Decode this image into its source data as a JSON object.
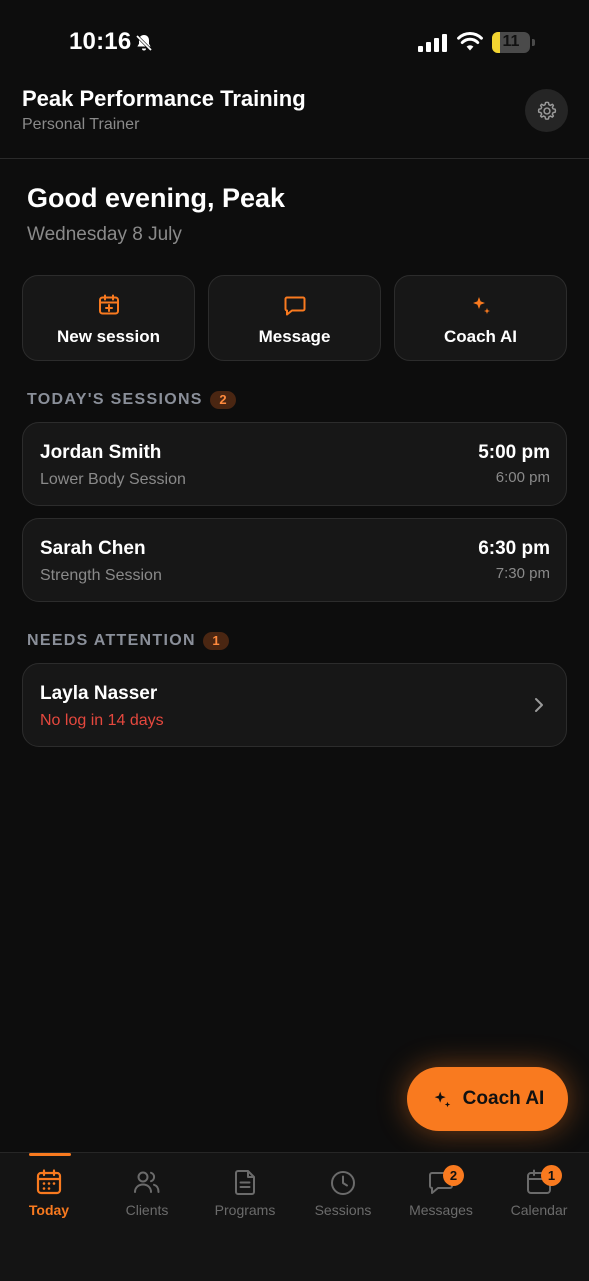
{
  "status_bar": {
    "time": "10:16",
    "battery_level": "11",
    "battery_fraction": 0.11,
    "battery_color": "#f2d431"
  },
  "header": {
    "title": "Peak Performance Training",
    "subtitle": "Personal Trainer",
    "settings_icon": "gear-icon"
  },
  "greeting": {
    "text": "Good evening, Peak",
    "date": "Wednesday 8 July"
  },
  "quick_actions": [
    {
      "label": "New session",
      "icon": "calendar-plus-icon"
    },
    {
      "label": "Message",
      "icon": "chat-icon"
    },
    {
      "label": "Coach AI",
      "icon": "sparkle-icon"
    }
  ],
  "todays_sessions": {
    "title": "TODAY'S SESSIONS",
    "count": "2",
    "items": [
      {
        "name": "Jordan Smith",
        "type": "Lower Body Session",
        "start": "5:00 pm",
        "end": "6:00 pm"
      },
      {
        "name": "Sarah Chen",
        "type": "Strength Session",
        "start": "6:30 pm",
        "end": "7:30 pm"
      }
    ]
  },
  "needs_attention": {
    "title": "NEEDS ATTENTION",
    "count": "1",
    "items": [
      {
        "name": "Layla Nasser",
        "note": "No log in 14 days"
      }
    ]
  },
  "fab": {
    "label": "Coach AI",
    "icon": "sparkle-icon"
  },
  "tab_bar": [
    {
      "label": "Today",
      "icon": "calendar-icon",
      "active": true
    },
    {
      "label": "Clients",
      "icon": "users-icon"
    },
    {
      "label": "Programs",
      "icon": "document-icon"
    },
    {
      "label": "Sessions",
      "icon": "clock-icon"
    },
    {
      "label": "Messages",
      "icon": "chat-icon",
      "badge": "2"
    },
    {
      "label": "Calendar",
      "icon": "calendar-icon",
      "badge": "1"
    }
  ],
  "colors": {
    "accent": "#f97a1f",
    "background": "#0d0d0d",
    "card": "#171717",
    "warning_text": "#e5483e",
    "muted_text": "#8a8a8a"
  }
}
